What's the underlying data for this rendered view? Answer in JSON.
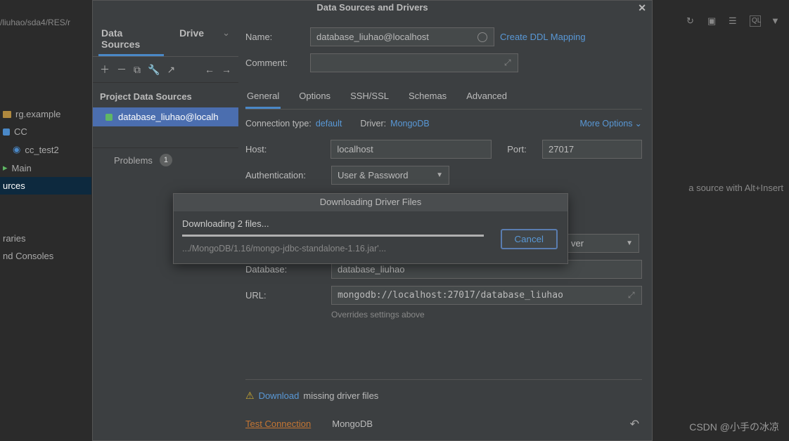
{
  "breadcrumb": "/liuhao/sda4/RES/r",
  "bgtree": {
    "items": [
      "rg.example",
      "CC",
      "cc_test2",
      "Main",
      "urces",
      "raries",
      "nd Consoles"
    ],
    "selected_index": 4
  },
  "bg_rightpane": "a source with Alt+Insert",
  "dialog_title": "Data Sources and Drivers",
  "left": {
    "tabs": [
      "Data Sources",
      "Drive"
    ],
    "active_tab": 0,
    "section_title": "Project Data Sources",
    "ds_item": "database_liuhao@localh",
    "problems_label": "Problems",
    "problems_count": "1"
  },
  "form": {
    "name_label": "Name:",
    "name_value": "database_liuhao@localhost",
    "ddl_link": "Create DDL Mapping",
    "comment_label": "Comment:",
    "tabs": [
      "General",
      "Options",
      "SSH/SSL",
      "Schemas",
      "Advanced"
    ],
    "active_tab": 0,
    "conn_type_label": "Connection type:",
    "conn_type_value": "default",
    "driver_label": "Driver:",
    "driver_value": "MongoDB",
    "more_options": "More Options",
    "host_label": "Host:",
    "host_value": "localhost",
    "port_label": "Port:",
    "port_value": "27017",
    "auth_label": "Authentication:",
    "auth_value": "User & Password",
    "save_value": "ver",
    "database_label": "Database:",
    "database_value": "database_liuhao",
    "url_label": "URL:",
    "url_value": "mongodb://localhost:27017/database_liuhao",
    "url_hint": "Overrides settings above",
    "download_link": "Download",
    "download_suffix": " missing driver files",
    "test_connection": "Test Connection",
    "driver_name": "MongoDB"
  },
  "download_modal": {
    "title": "Downloading Driver Files",
    "status": "Downloading 2 files...",
    "path": ".../MongoDB/1.16/mongo-jdbc-standalone-1.16.jar'...",
    "cancel": "Cancel"
  },
  "watermark": "CSDN @小手の冰凉"
}
